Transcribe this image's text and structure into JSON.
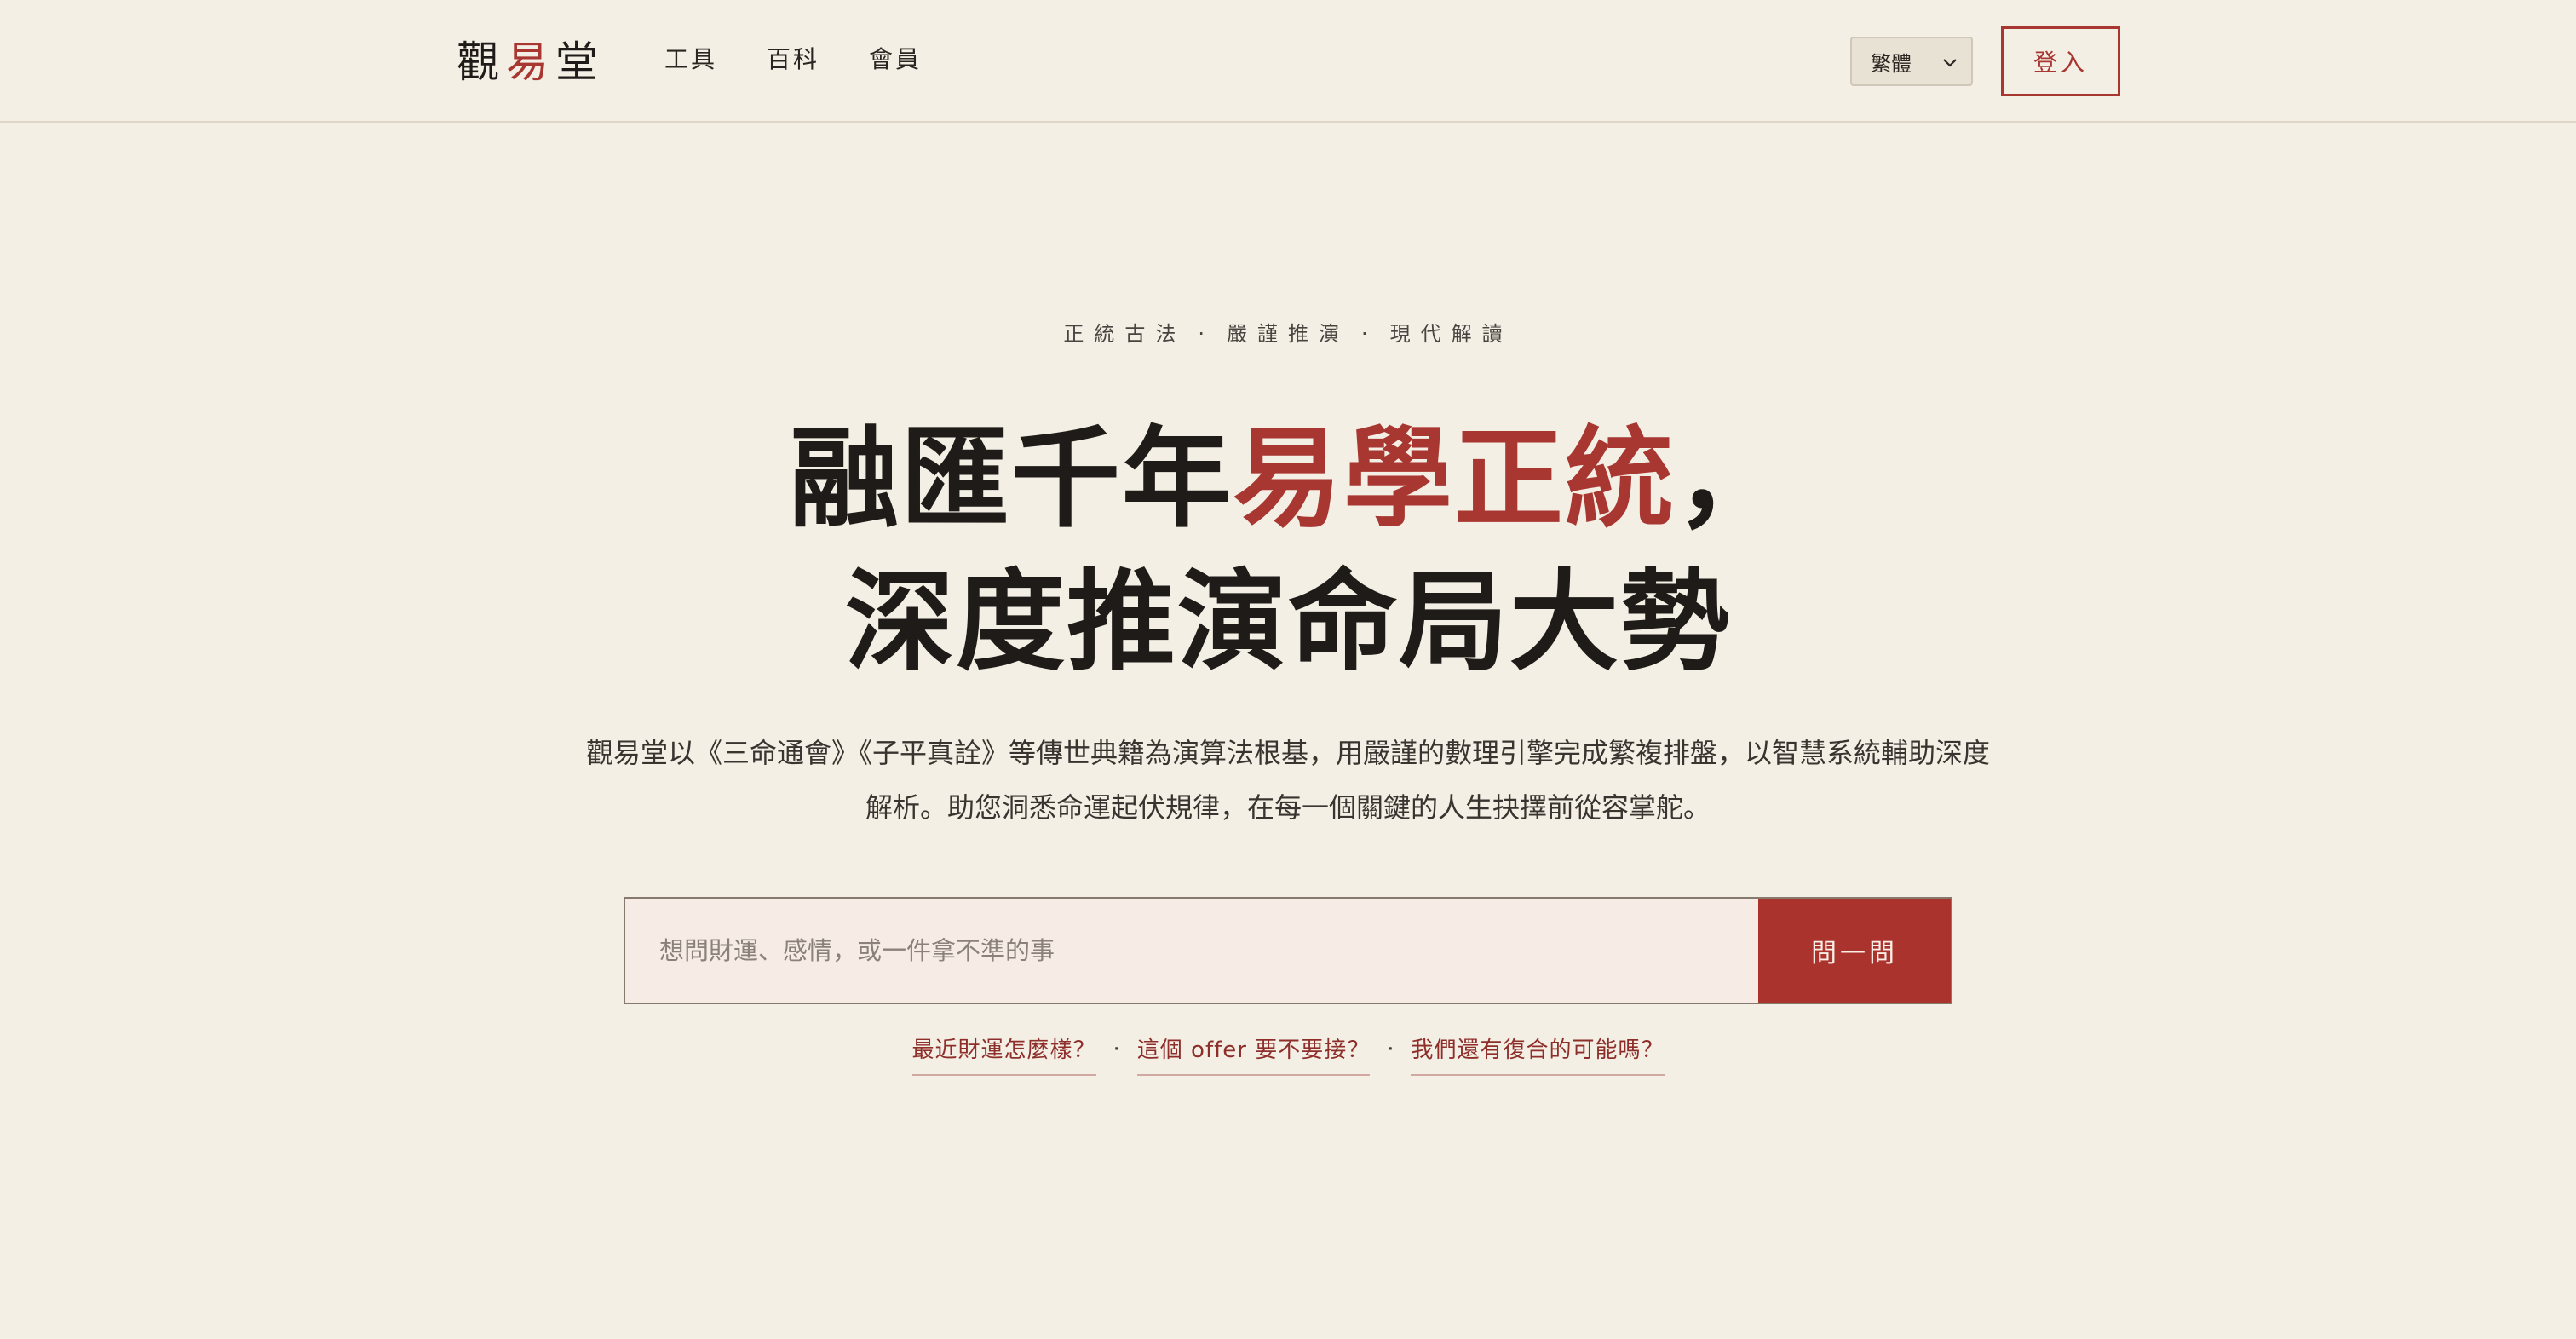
{
  "header": {
    "logo": {
      "part1": "觀",
      "accent": "易",
      "part2": "堂"
    },
    "nav": [
      {
        "label": "工具"
      },
      {
        "label": "百科"
      },
      {
        "label": "會員"
      }
    ],
    "language": {
      "selected": "繁體"
    },
    "login_label": "登入"
  },
  "hero": {
    "tagline": {
      "item1": "正統古法",
      "item2": "嚴謹推演",
      "item3": "現代解讀",
      "separator": "·"
    },
    "title_line1_prefix": "融匯千年",
    "title_line1_accent": "易學正統",
    "title_line1_suffix": "，",
    "title_line2": "深度推演命局大勢",
    "description_line1": "觀易堂以《三命通會》《子平真詮》等傳世典籍為演算法根基，用嚴謹的數理引擎完成繁複排盤，以智慧系統輔助深度",
    "description_line2": "解析。助您洞悉命運起伏規律，在每一個關鍵的人生抉擇前從容掌舵。"
  },
  "search": {
    "placeholder": "想問財運、感情，或一件拿不準的事",
    "value": "",
    "button_label": "問一問"
  },
  "suggestions": {
    "separator": "·",
    "items": [
      {
        "label": "最近財運怎麼樣？"
      },
      {
        "label": "這個 offer 要不要接？"
      },
      {
        "label": "我們還有復合的可能嗎？"
      }
    ]
  },
  "colors": {
    "background": "#f4efe4",
    "accent": "#a83631",
    "button": "#aa332d",
    "text": "#1f1b18"
  }
}
